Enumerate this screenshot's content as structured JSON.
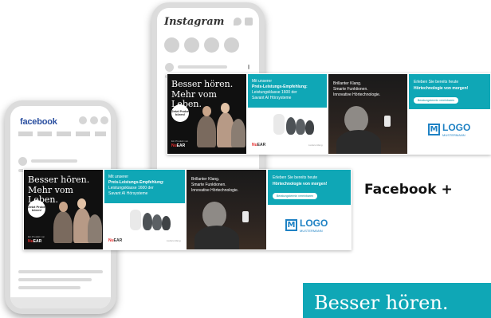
{
  "instagram_phone": {
    "app_name": "Instagram"
  },
  "facebook_phone": {
    "app_name": "facebook"
  },
  "ads": {
    "card1": {
      "headline_line1": "Besser hören.",
      "headline_line2": "Mehr vom Leben.",
      "badge": "Jetzt Probe hören!",
      "brand_prefix": "Nu",
      "brand_suffix": "EAR",
      "brand_note": "Ein Produkt von"
    },
    "card2": {
      "line1": "Mit unserer",
      "line2": "Preis-Leistungs-Empfehlung:",
      "line3": "Leistungsklasse 1600 der",
      "line4": "Savant AI Hörsysteme",
      "brand_prefix": "Nu",
      "brand_suffix": "EAR",
      "note": "Lieferumfang"
    },
    "card3": {
      "line1": "Brillanter Klang.",
      "line2": "Smarte Funktionen.",
      "line3": "Innovative Hörtechnologie."
    },
    "card4": {
      "line1": "Erleben Sie bereits heute",
      "line2": "Hörtechnologie von morgen!",
      "button": "Beratungstermin vereinbaren",
      "logo_mark": "M",
      "logo_word": "LOGO",
      "logo_sub": "MUSTERMANN"
    }
  },
  "caption": "Facebook +",
  "banner_text": "Besser hören.",
  "colors": {
    "teal": "#0fa7b6",
    "facebook_blue": "#2a4fa0",
    "logo_blue": "#1f82c4",
    "brand_red": "#e62b2b"
  }
}
